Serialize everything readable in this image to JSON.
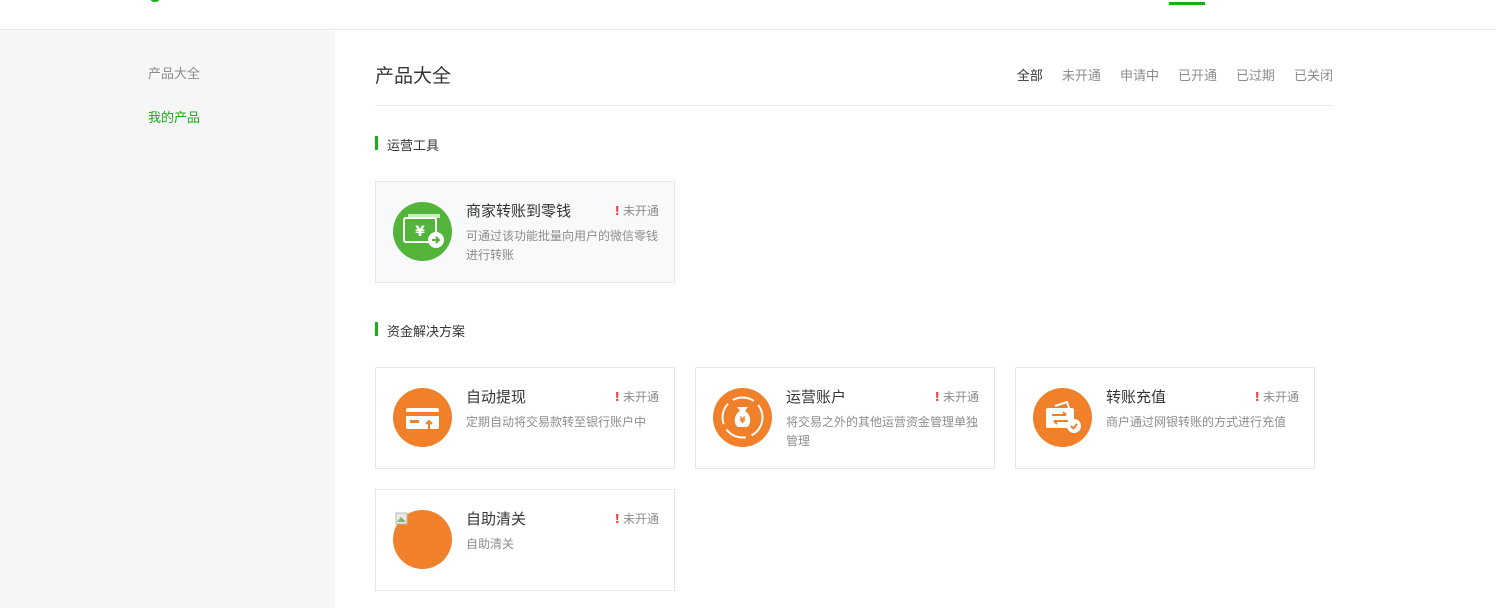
{
  "sidebar": {
    "items": [
      {
        "label": "产品大全"
      },
      {
        "label": "我的产品"
      }
    ]
  },
  "main": {
    "title": "产品大全",
    "filters": [
      "全部",
      "未开通",
      "申请中",
      "已开通",
      "已过期",
      "已关闭"
    ],
    "active_filter": "全部",
    "sections": [
      {
        "title": "运营工具",
        "cards": [
          {
            "name": "商家转账到零钱",
            "status": "未开通",
            "desc": "可通过该功能批量向用户的微信零钱进行转账",
            "icon": "wallet-transfer-icon",
            "color": "#52b53a"
          }
        ]
      },
      {
        "title": "资金解决方案",
        "cards": [
          {
            "name": "自动提现",
            "status": "未开通",
            "desc": "定期自动将交易款转至银行账户中",
            "icon": "card-withdraw-icon",
            "color": "#f0812a"
          },
          {
            "name": "运营账户",
            "status": "未开通",
            "desc": "将交易之外的其他运营资金管理单独管理",
            "icon": "money-bag-icon",
            "color": "#f0812a"
          },
          {
            "name": "转账充值",
            "status": "未开通",
            "desc": "商户通过网银转账的方式进行充值",
            "icon": "transfer-recharge-icon",
            "color": "#f0812a"
          },
          {
            "name": "自助清关",
            "status": "未开通",
            "desc": "自助清关",
            "icon": "broken-image-icon",
            "color": "#f0812a"
          }
        ]
      }
    ]
  },
  "status_mark": "!"
}
